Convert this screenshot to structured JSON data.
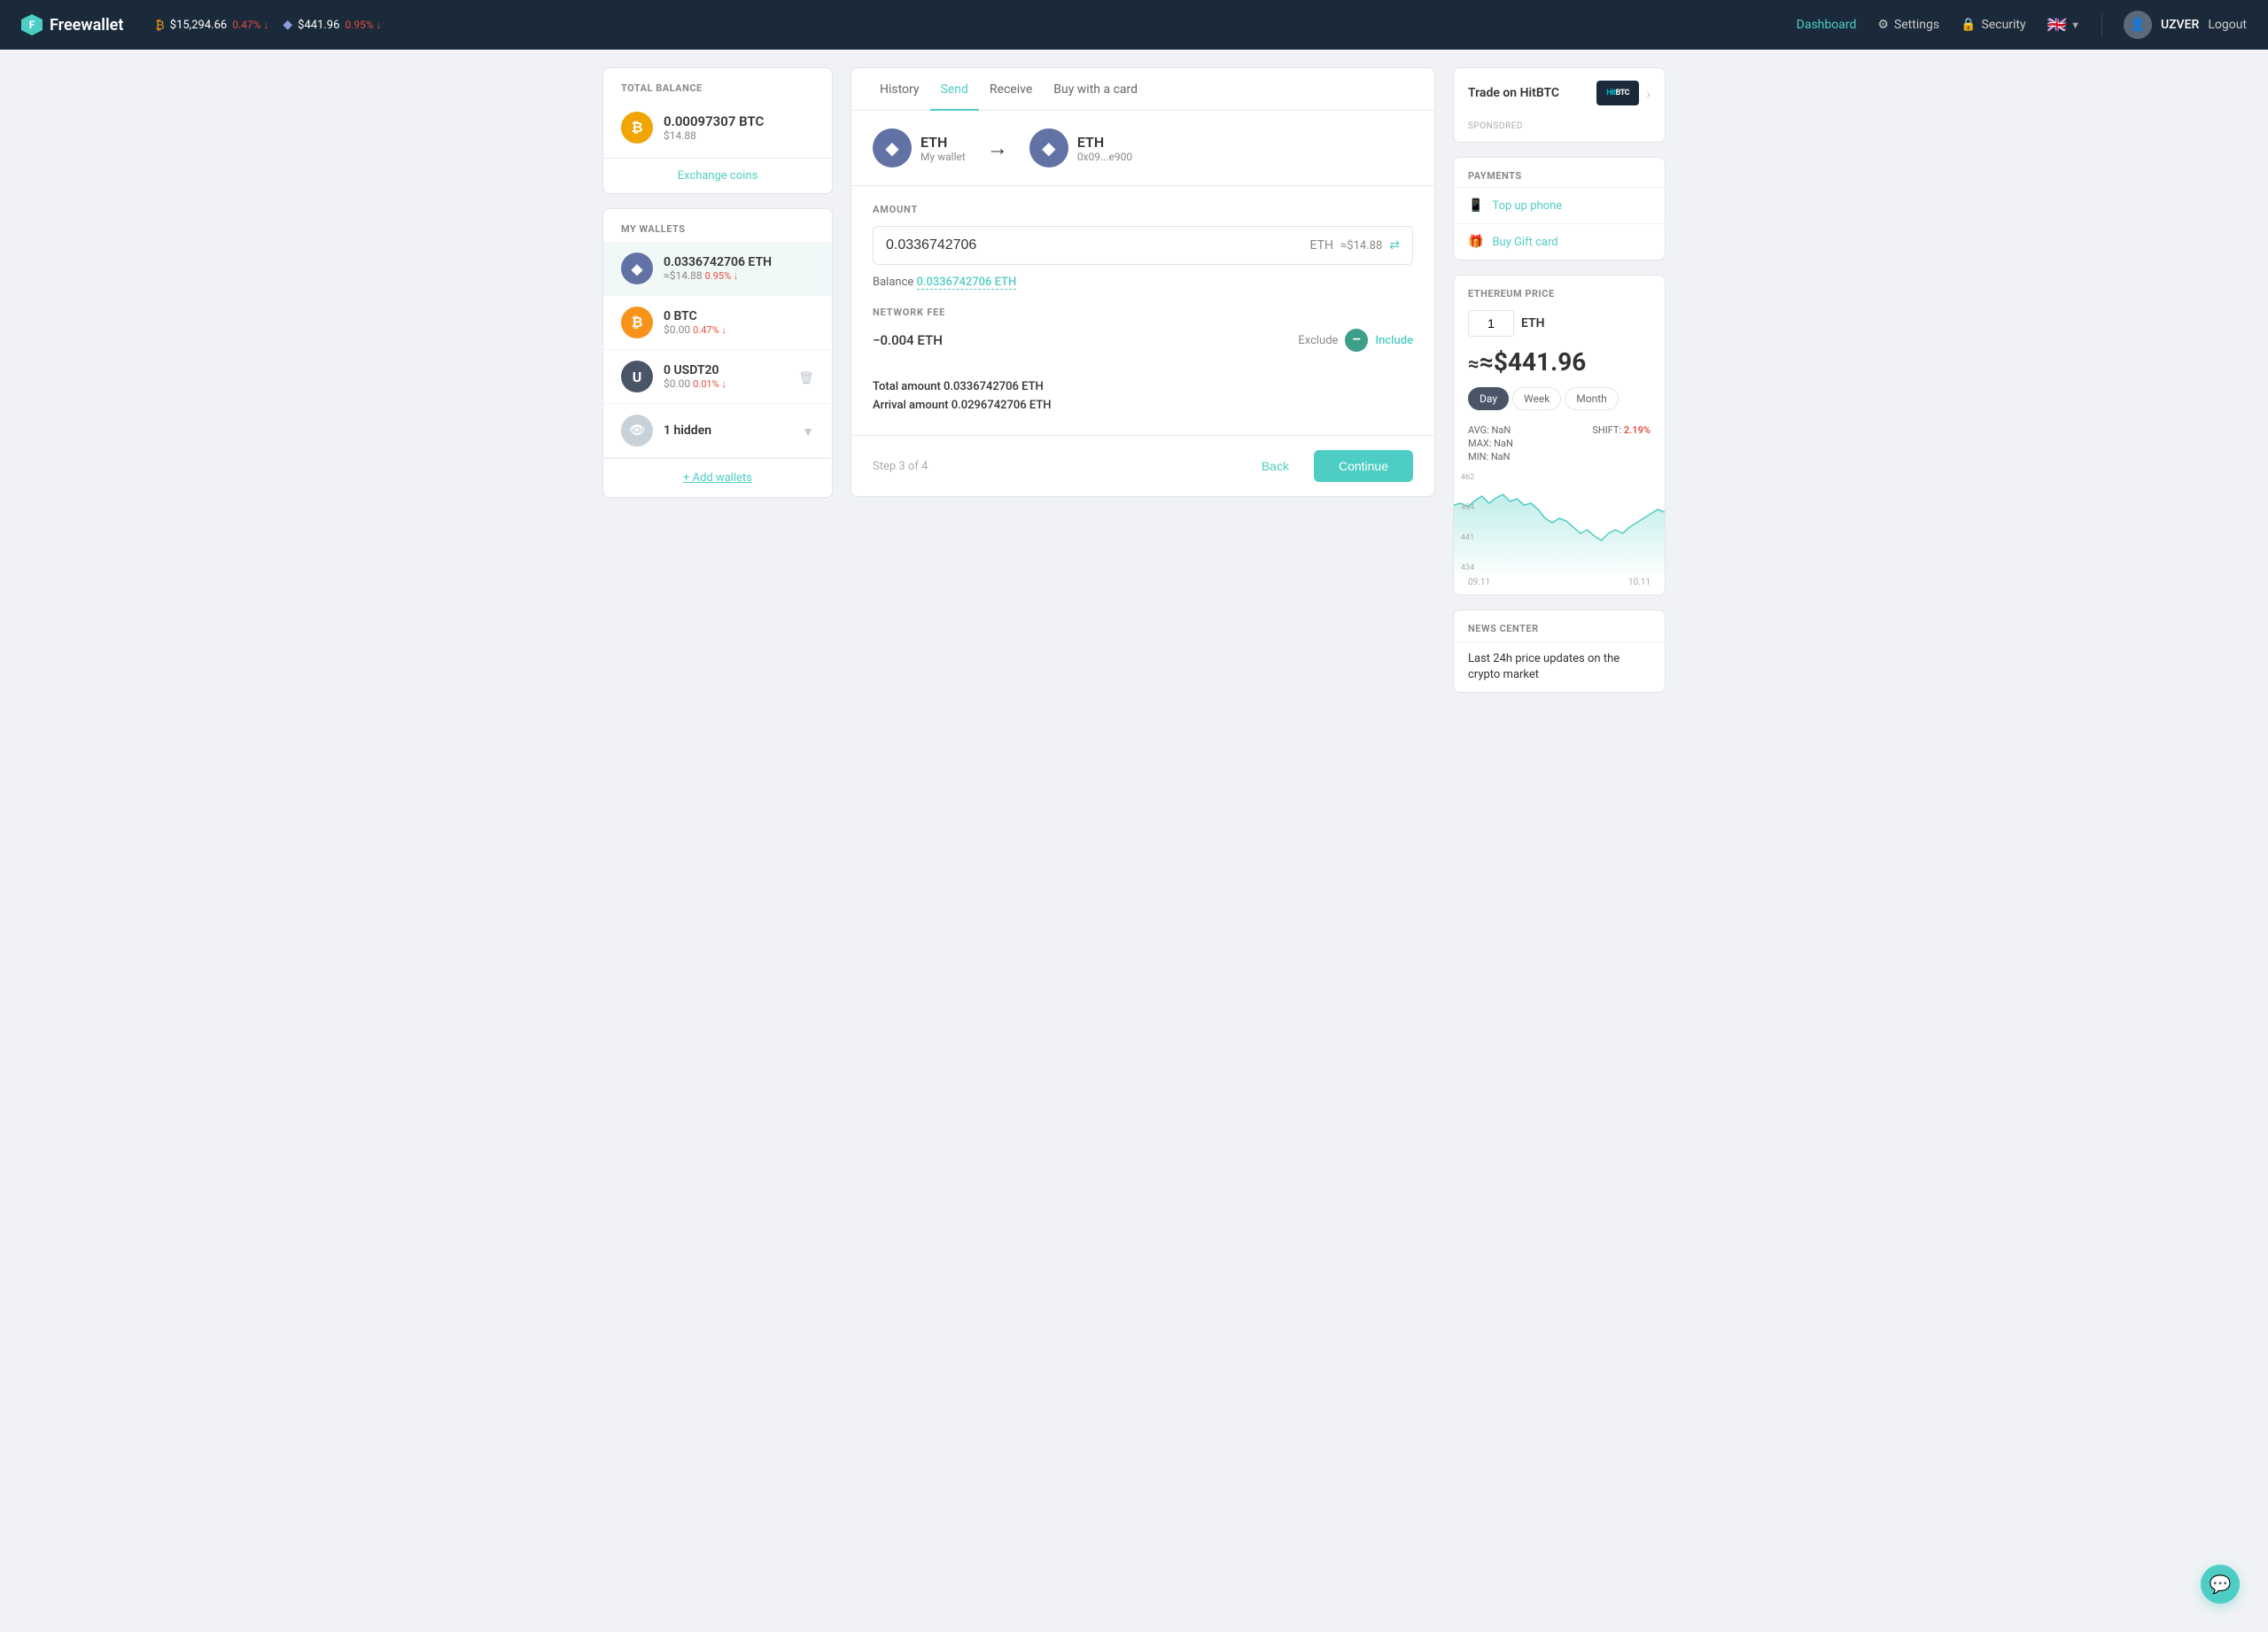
{
  "header": {
    "logo_text": "Freewallet",
    "btc_price": "$15,294.66",
    "btc_change": "0.47%",
    "eth_price": "$441.96",
    "eth_change": "0.95%",
    "nav": {
      "dashboard": "Dashboard",
      "settings": "Settings",
      "security": "Security"
    },
    "flag": "🇬🇧",
    "username": "UZVER",
    "logout": "Logout"
  },
  "left_panel": {
    "total_balance_label": "TOTAL BALANCE",
    "btc_balance": "0.00097307 BTC",
    "btc_usd": "$14.88",
    "exchange_link": "Exchange coins",
    "my_wallets_label": "MY WALLETS",
    "wallets": [
      {
        "symbol": "ETH",
        "amount": "0.0336742706 ETH",
        "usd": "≈$14.88",
        "change": "0.95% ↓",
        "icon_char": "◆"
      },
      {
        "symbol": "BTC",
        "amount": "0 BTC",
        "usd": "$0.00",
        "change": "0.47% ↓",
        "icon_char": "₿"
      },
      {
        "symbol": "USDT20",
        "amount": "0 USDT20",
        "usd": "$0.00",
        "change": "0.01% ↓",
        "icon_char": "U"
      },
      {
        "symbol": "hidden",
        "amount": "1 hidden",
        "usd": "",
        "change": "",
        "icon_char": "👁"
      }
    ],
    "add_wallets": "+ Add wallets"
  },
  "center_panel": {
    "tabs": [
      "History",
      "Send",
      "Receive",
      "Buy with a card"
    ],
    "active_tab": "Send",
    "from_coin": "ETH",
    "from_label": "My wallet",
    "to_coin": "ETH",
    "to_label": "0x09...e900",
    "amount_label": "AMOUNT",
    "amount_value": "0.0336742706",
    "amount_currency": "ETH",
    "amount_usd": "≈$14.88",
    "balance_prefix": "Balance",
    "balance_value": "0.0336742706 ETH",
    "network_fee_label": "NETWORK FEE",
    "fee_value": "−0.004 ETH",
    "fee_exclude": "Exclude",
    "fee_include": "Include",
    "total_amount_label": "Total amount",
    "total_amount_value": "0.0336742706 ETH",
    "arrival_amount_label": "Arrival amount",
    "arrival_amount_value": "0.0296742706 ETH",
    "step_text": "Step 3 of 4",
    "back_btn": "Back",
    "continue_btn": "Continue"
  },
  "right_panel": {
    "hitbtc_label": "Trade on HitBTC",
    "hitbtc_logo": "HitBTC",
    "sponsored": "SPONSORED",
    "payments_label": "PAYMENTS",
    "top_up_phone": "Top up phone",
    "buy_gift_card": "Buy Gift card",
    "eth_price_label": "ETHEREUM PRICE",
    "eth_qty": "1",
    "eth_currency": "ETH",
    "eth_price": "≈$441.96",
    "time_tabs": [
      "Day",
      "Week",
      "Month"
    ],
    "active_time_tab": "Day",
    "stats": {
      "avg": "AVG: NaN",
      "max": "MAX: NaN",
      "min": "MIN: NaN",
      "shift_label": "SHIFT:",
      "shift_value": "2.19%"
    },
    "chart_y_labels": [
      "462",
      "454",
      "441",
      "434"
    ],
    "chart_x_labels": [
      "09.11",
      "10.11"
    ],
    "news_label": "NEWS CENTER",
    "news_item": "Last 24h price updates on the crypto market"
  }
}
